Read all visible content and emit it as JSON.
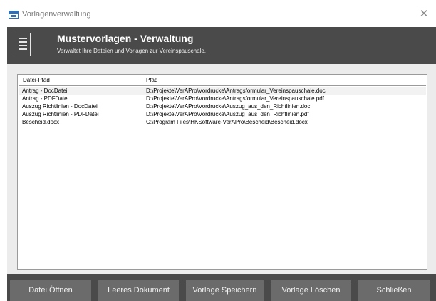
{
  "window": {
    "title": "Vorlagenverwaltung",
    "close_label": "✕"
  },
  "header": {
    "title": "Mustervorlagen - Verwaltung",
    "subtitle": "Verwaltet Ihre Dateien und Vorlagen zur Vereinspauschale."
  },
  "list": {
    "columns": [
      "Datei-Pfad",
      "Pfad"
    ],
    "rows": [
      {
        "name": "Antrag - DocDatei",
        "path": "D:\\Projekte\\VerAPro\\Vordrucke\\Antragsformular_Vereinspauschale.doc"
      },
      {
        "name": "Antrag - PDFDatei",
        "path": "D:\\Projekte\\VerAPro\\Vordrucke\\Antragsformular_Vereinspauschale.pdf"
      },
      {
        "name": "Auszug Richtlinien - DocDatei",
        "path": "D:\\Projekte\\VerAPro\\Vordrucke\\Auszug_aus_den_Richtlinien.doc"
      },
      {
        "name": "Auszug Richtlinien - PDFDatei",
        "path": "D:\\Projekte\\VerAPro\\Vordrucke\\Auszug_aus_den_Richtlinien.pdf"
      },
      {
        "name": "Bescheid.docx",
        "path": "C:\\Program Files\\HKSoftware-VerAPro\\Bescheid\\Bescheid.docx"
      }
    ]
  },
  "buttons": {
    "open": "Datei Öffnen",
    "empty_doc": "Leeres Dokument",
    "save_template": "Vorlage Speichern",
    "delete_template": "Vorlage Löschen",
    "close": "Schließen"
  }
}
